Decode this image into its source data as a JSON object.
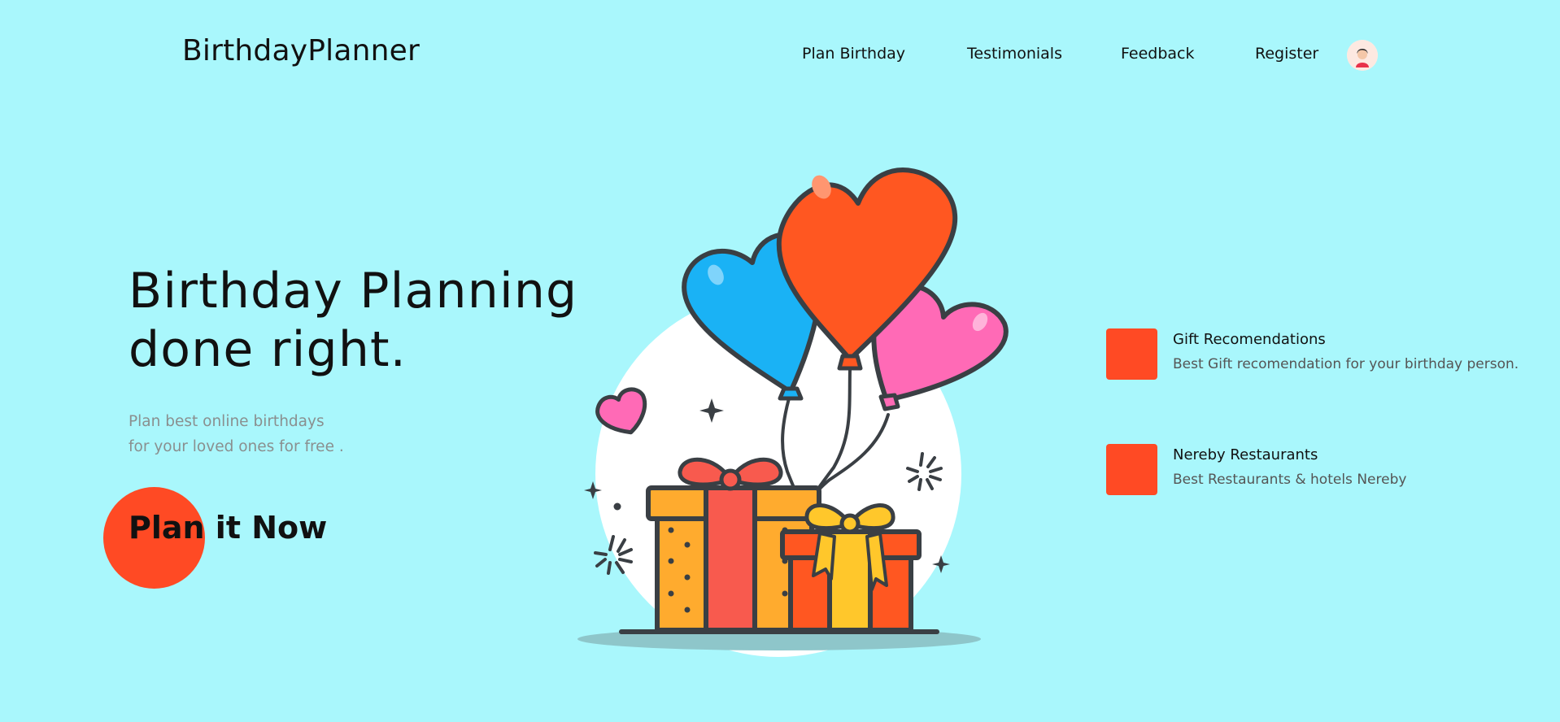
{
  "brand": "BirthdayPlanner",
  "nav": {
    "links": [
      "Plan Birthday",
      "Testimonials",
      "Feedback",
      "Register"
    ]
  },
  "hero": {
    "title_line1": "Birthday Planning",
    "title_line2": "done right.",
    "subtitle_line1": "Plan best online birthdays",
    "subtitle_line2": "for your loved ones for free .",
    "cta": "Plan it Now"
  },
  "features": [
    {
      "title": "Gift Recomendations",
      "description": "Best Gift recomendation for your birthday person."
    },
    {
      "title": "Nereby Restaurants",
      "description": "Best Restaurants & hotels Nereby"
    }
  ],
  "colors": {
    "background": "#a9f7fc",
    "accent": "#ff4a24"
  }
}
